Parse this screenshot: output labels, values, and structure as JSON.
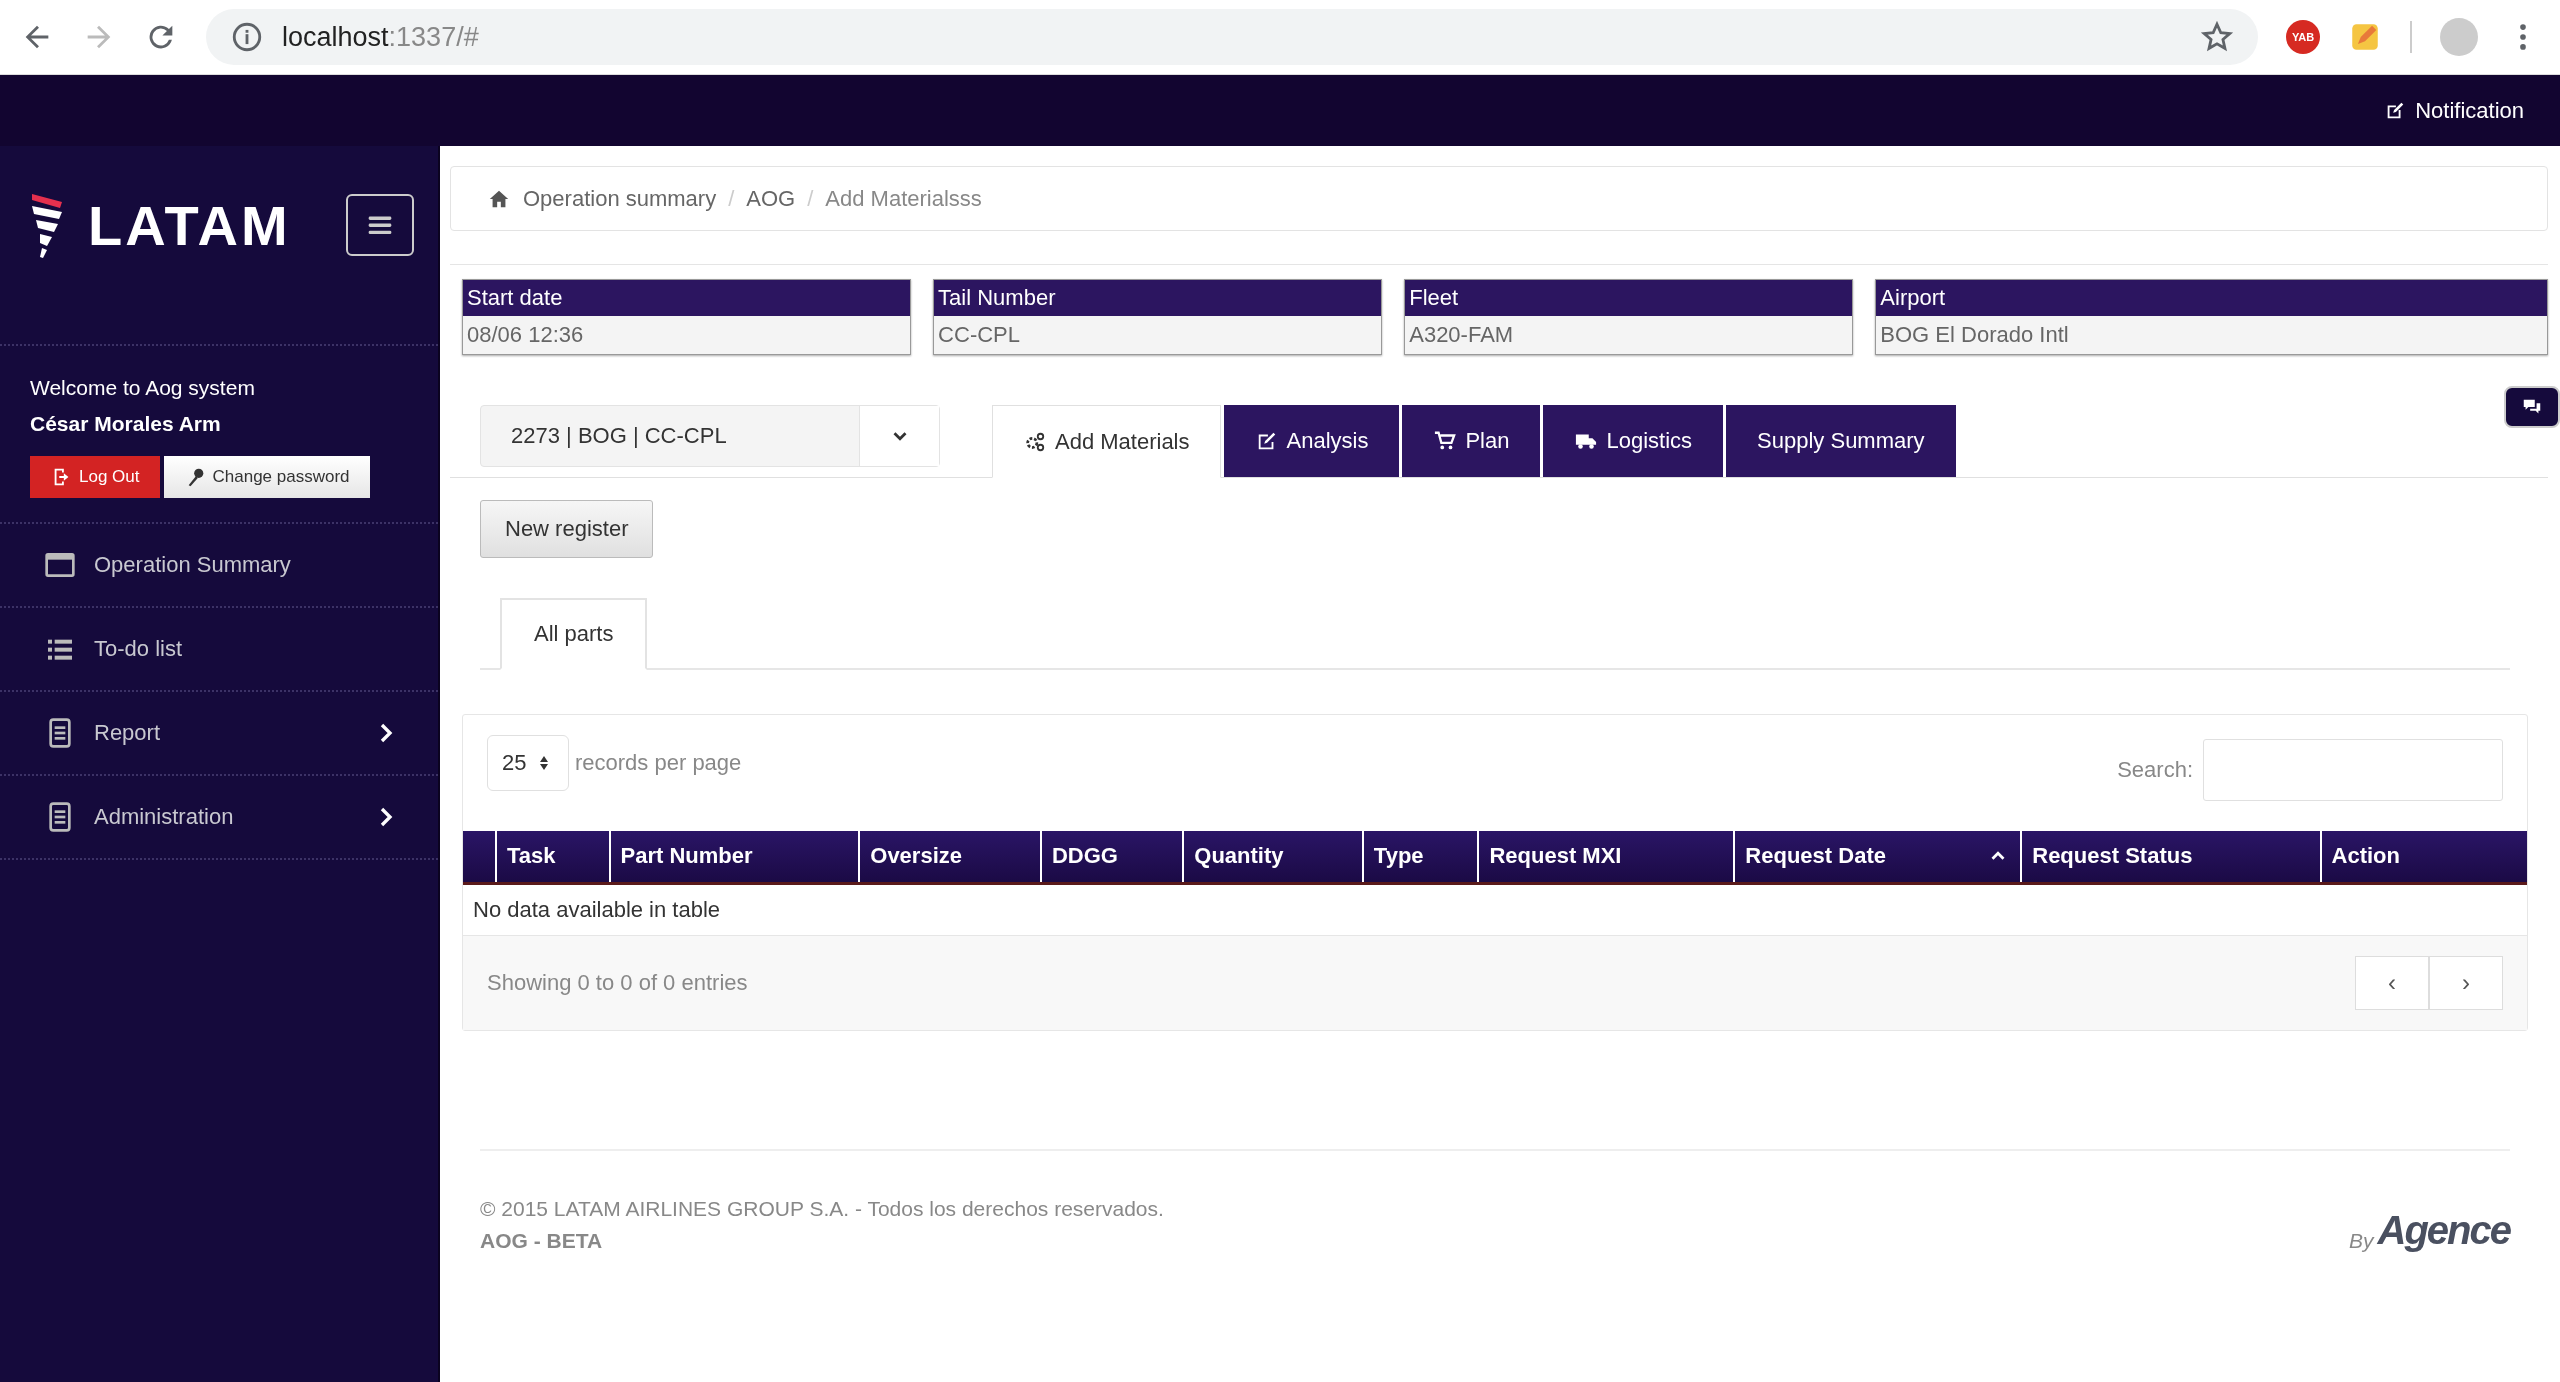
{
  "browser": {
    "host": "localhost",
    "path": ":1337/#",
    "extension_badge": "YAB"
  },
  "navbar": {
    "notification": "Notification"
  },
  "sidebar": {
    "brand": "LATAM",
    "welcome": "Welcome to Aog system",
    "user": "César Morales Arm",
    "logout": "Log Out",
    "change_password": "Change password",
    "items": [
      {
        "label": "Operation Summary",
        "kind": "window",
        "expandable": false
      },
      {
        "label": "To-do list",
        "kind": "list",
        "expandable": false
      },
      {
        "label": "Report",
        "kind": "document",
        "expandable": true
      },
      {
        "label": "Administration",
        "kind": "document",
        "expandable": true
      }
    ]
  },
  "breadcrumb": {
    "separator": "/",
    "items": [
      "Operation summary",
      "AOG",
      "Add Materialsss"
    ]
  },
  "info_fields": [
    {
      "label": "Start date",
      "value": "08/06 12:36"
    },
    {
      "label": "Tail Number",
      "value": "CC-CPL"
    },
    {
      "label": "Fleet",
      "value": "A320-FAM"
    },
    {
      "label": "Airport",
      "value": "BOG El Dorado Intl"
    }
  ],
  "selector": {
    "value": "2273 | BOG | CC-CPL"
  },
  "tabs": [
    {
      "label": "Add Materials",
      "kind": "gears",
      "selected": true
    },
    {
      "label": "Analysis",
      "kind": "edit",
      "selected": false
    },
    {
      "label": "Plan",
      "kind": "cart",
      "selected": false
    },
    {
      "label": "Logistics",
      "kind": "truck",
      "selected": false
    },
    {
      "label": "Supply Summary",
      "kind": "plain",
      "selected": false
    }
  ],
  "new_register": "New register",
  "subtabs": [
    {
      "label": "All parts",
      "selected": true
    }
  ],
  "table": {
    "page_length": "25",
    "length_label": "records per page",
    "search_label": "Search:",
    "columns": [
      {
        "label": "Task",
        "sorted": false
      },
      {
        "label": "Part Number",
        "sorted": false
      },
      {
        "label": "Oversize",
        "sorted": false
      },
      {
        "label": "DDGG",
        "sorted": false
      },
      {
        "label": "Quantity",
        "sorted": false
      },
      {
        "label": "Type",
        "sorted": false
      },
      {
        "label": "Request MXI",
        "sorted": false
      },
      {
        "label": "Request Date",
        "sorted": true
      },
      {
        "label": "Request Status",
        "sorted": false
      },
      {
        "label": "Action",
        "sorted": false
      }
    ],
    "empty": "No data available in table",
    "info": "Showing 0 to 0 of 0 entries",
    "prev": "‹",
    "next": "›"
  },
  "footer": {
    "copyright": "© 2015 LATAM AIRLINES GROUP S.A. - Todos los derechos reservados.",
    "version": "AOG - BETA",
    "by": "By",
    "maker": "Agence"
  }
}
